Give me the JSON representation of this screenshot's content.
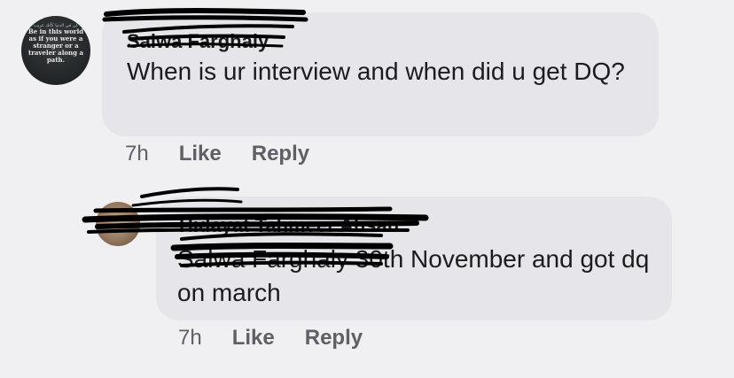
{
  "comments": [
    {
      "avatar_quote": "Be in this world as if you were a stranger or a traveler along a path.",
      "author": "Salwa Farghaly",
      "text": "When is ur interview and when did u get DQ?",
      "time": "7h",
      "like_label": "Like",
      "reply_label": "Reply"
    },
    {
      "author": "Hidayat Tahmeer Ahsan",
      "mention": "Salwa Farghaly",
      "text": " 30th November and got dq on march",
      "time": "7h",
      "like_label": "Like",
      "reply_label": "Reply"
    }
  ],
  "colors": {
    "background": "#f0f0f2",
    "bubble": "#e5e5ea",
    "meta_text": "#5f5f66",
    "redaction": "#000000"
  }
}
